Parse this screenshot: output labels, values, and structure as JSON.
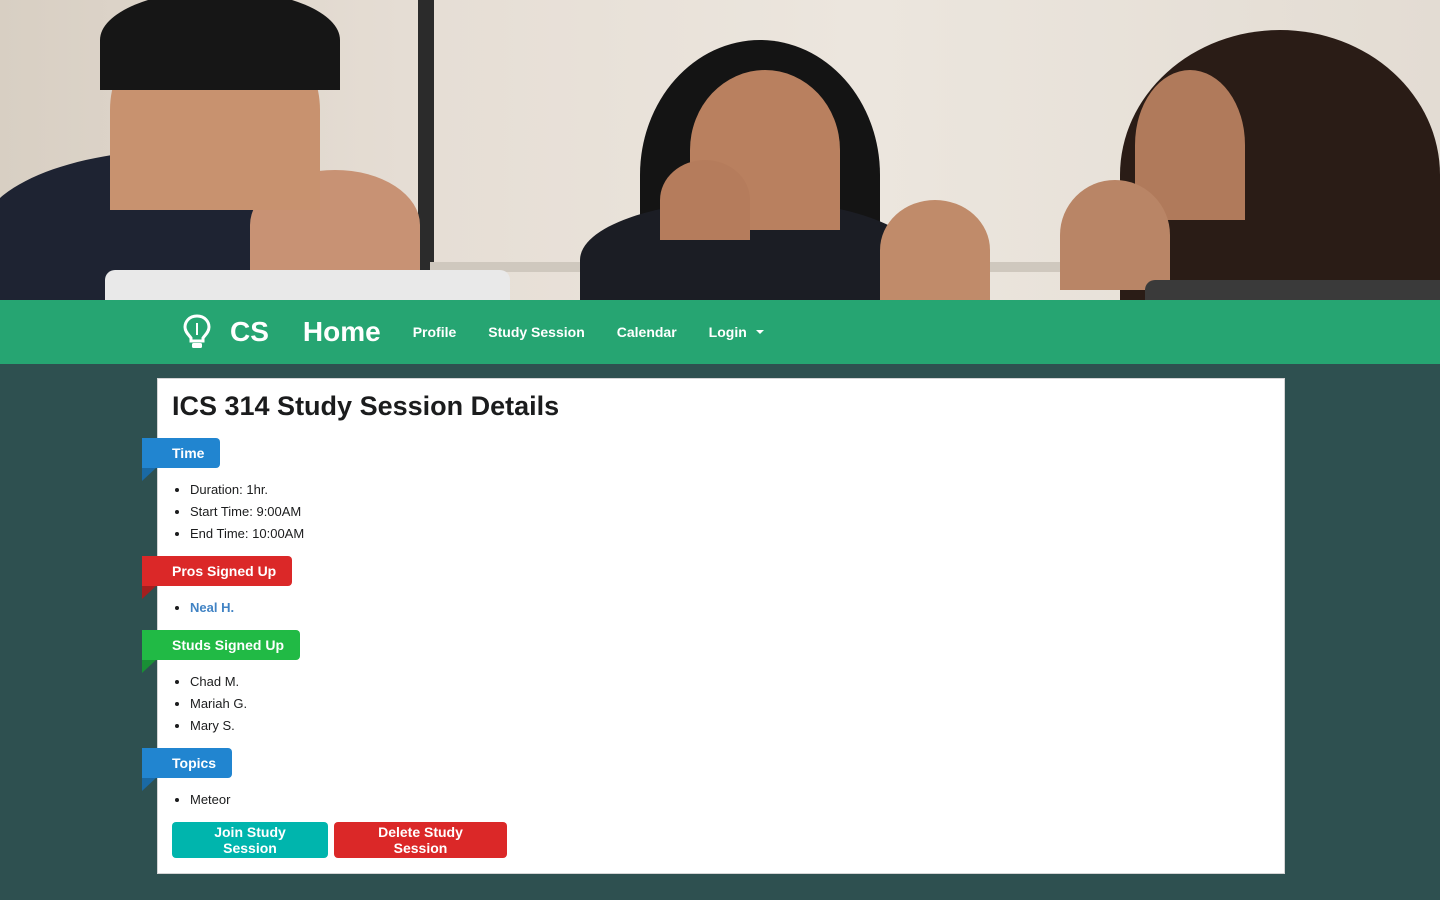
{
  "hero": {
    "image": "students-laughing-photo"
  },
  "nav": {
    "logo_icon": "lightbulb-icon",
    "brand": "CS",
    "home": "Home",
    "items": [
      "Profile",
      "Study Session",
      "Calendar"
    ],
    "login": "Login"
  },
  "page": {
    "title": "ICS 314 Study Session Details",
    "sections": {
      "time": {
        "label": "Time",
        "items": [
          "Duration: 1hr.",
          "Start Time: 9:00AM",
          "End Time: 10:00AM"
        ]
      },
      "pros": {
        "label": "Pros Signed Up",
        "items": [
          "Neal H."
        ]
      },
      "studs": {
        "label": "Studs Signed Up",
        "items": [
          "Chad M.",
          "Mariah G.",
          "Mary S."
        ]
      },
      "topics": {
        "label": "Topics",
        "items": [
          "Meteor"
        ]
      }
    },
    "buttons": {
      "join": "Join Study Session",
      "delete": "Delete Study Session"
    }
  },
  "colors": {
    "nav_green": "#26a572",
    "background": "#2e5050",
    "ribbon_blue": "#2185d0",
    "ribbon_red": "#db2828",
    "ribbon_green": "#21ba45",
    "button_teal": "#00b5ad"
  }
}
